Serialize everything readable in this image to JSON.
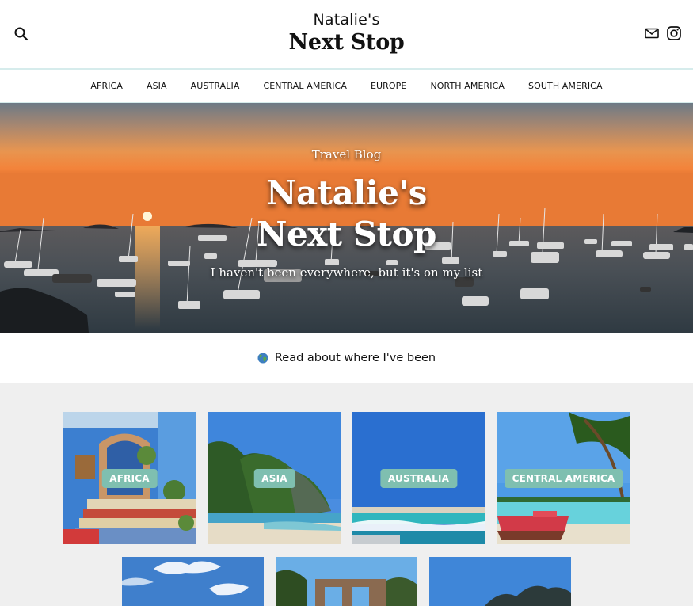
{
  "header": {
    "brand_top": "Natalie's",
    "brand_main": "Next Stop",
    "search_icon": "search-icon",
    "mail_icon": "mail-icon",
    "instagram_icon": "instagram-icon"
  },
  "nav": {
    "items": [
      "AFRICA",
      "ASIA",
      "AUSTRALIA",
      "CENTRAL AMERICA",
      "EUROPE",
      "NORTH AMERICA",
      "SOUTH AMERICA"
    ]
  },
  "hero": {
    "kicker": "Travel Blog",
    "title_line1": "Natalie's",
    "title_line2": "Next Stop",
    "subtitle": "I haven't been everywhere, but it's on my list"
  },
  "read_band": {
    "icon": "globe-icon",
    "text": "Read about where I've been"
  },
  "regions": [
    {
      "label": "AFRICA"
    },
    {
      "label": "ASIA"
    },
    {
      "label": "AUSTRALIA"
    },
    {
      "label": "CENTRAL AMERICA"
    }
  ],
  "colors": {
    "badge": "#7fbfb0",
    "nav_border": "#d6ecec",
    "grid_bg": "#efefef"
  }
}
